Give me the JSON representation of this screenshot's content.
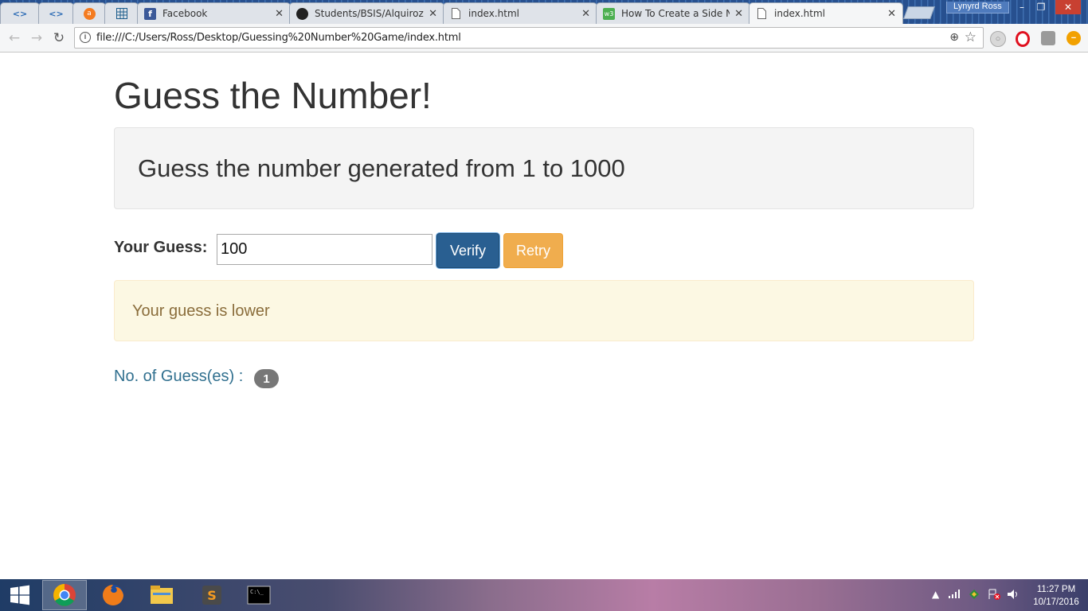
{
  "browser": {
    "tabs": [
      {
        "title": "",
        "icon": "code-icon"
      },
      {
        "title": "",
        "icon": "code-icon"
      },
      {
        "title": "",
        "icon": "avast-icon"
      },
      {
        "title": "",
        "icon": "grid-icon"
      },
      {
        "title": "Facebook",
        "icon": "facebook-icon"
      },
      {
        "title": "Students/BSIS/Alquiroz-I",
        "icon": "github-icon"
      },
      {
        "title": "index.html",
        "icon": "page-icon"
      },
      {
        "title": "How To Create a Side Na",
        "icon": "w3schools-icon"
      },
      {
        "title": "index.html",
        "icon": "page-icon",
        "active": true
      }
    ],
    "close_glyph": "✕",
    "profile_name": "Lynyrd Ross",
    "address": "file:///C:/Users/Ross/Desktop/Guessing%20Number%20Game/index.html"
  },
  "page": {
    "title": "Guess the Number!",
    "instructions": "Guess the number generated from 1 to 1000",
    "guess_label": "Your Guess:",
    "guess_value": "100",
    "verify_label": "Verify",
    "retry_label": "Retry",
    "feedback": "Your guess is lower",
    "count_label": "No. of Guess(es) :",
    "count_value": "1"
  },
  "taskbar": {
    "apps": [
      "chrome-icon",
      "firefox-icon",
      "file-explorer-icon",
      "sublime-text-icon",
      "command-prompt-icon"
    ],
    "time": "11:27 PM",
    "date": "10/17/2016"
  },
  "colors": {
    "primary": "#295f91",
    "warning": "#f0ad4e",
    "alert_bg": "#fcf8e3",
    "alert_text": "#8a6d3b",
    "info_text": "#31708f"
  }
}
